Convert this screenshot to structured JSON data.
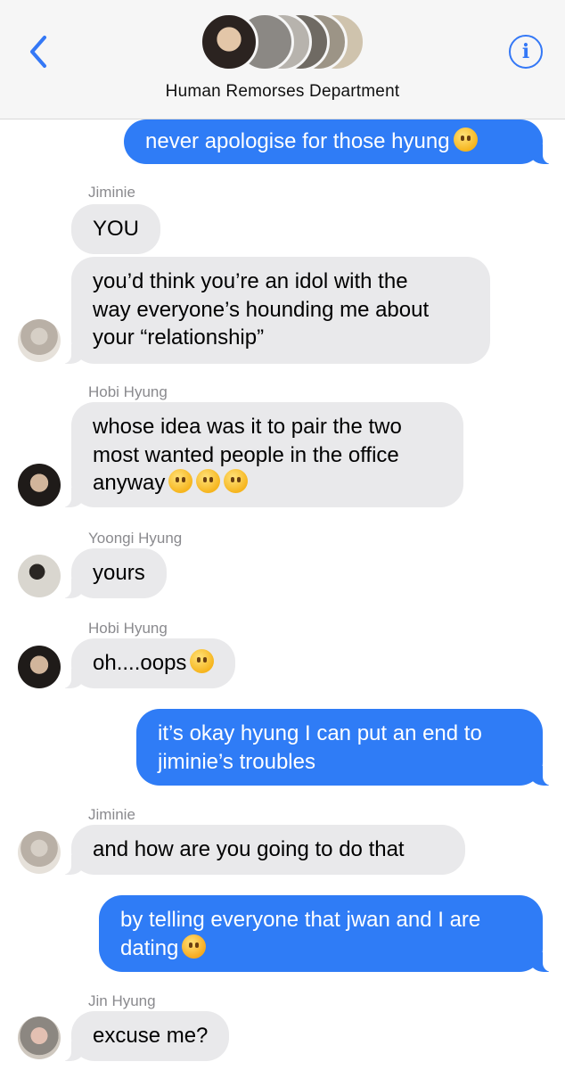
{
  "header": {
    "title": "Human Remorses Department",
    "back_icon": "chevron-left-icon",
    "info_icon_label": "i",
    "accent": "#3478f6"
  },
  "messages": [
    {
      "side": "out",
      "text": "never apologise for those hyung",
      "emoji": [
        "steam-face"
      ]
    },
    {
      "sender": "Jiminie",
      "side": "in",
      "text": "YOU"
    },
    {
      "side": "in",
      "lines": [
        "you’d think you’re an idol with the",
        "way everyone’s hounding me about",
        "your “relationship”"
      ]
    },
    {
      "sender": "Hobi Hyung",
      "side": "in",
      "lines": [
        "whose idea was it to pair the two",
        "most wanted people in the office",
        "anyway"
      ],
      "emoji": [
        "thinking-face",
        "thinking-face",
        "thinking-face"
      ]
    },
    {
      "sender": "Yoongi Hyung",
      "side": "in",
      "text": "yours"
    },
    {
      "sender": "Hobi Hyung",
      "side": "in",
      "text": "oh....oops",
      "emoji": [
        "sweat-smile-face"
      ]
    },
    {
      "side": "out",
      "lines": [
        "it’s okay hyung I can put an end to",
        "jiminie’s troubles"
      ]
    },
    {
      "sender": "Jiminie",
      "side": "in",
      "text": "and how are you going to do that"
    },
    {
      "side": "out",
      "lines": [
        "by telling everyone that jwan and I are",
        "dating"
      ],
      "emoji": [
        "smiling-face-with-hearts"
      ]
    },
    {
      "sender": "Jin Hyung",
      "side": "in",
      "text": "excuse me?"
    }
  ],
  "colors": {
    "incoming_bubble": "#e9e9eb",
    "outgoing_bubble": "#2f7cf6",
    "sender_name": "#8a8a8e"
  }
}
